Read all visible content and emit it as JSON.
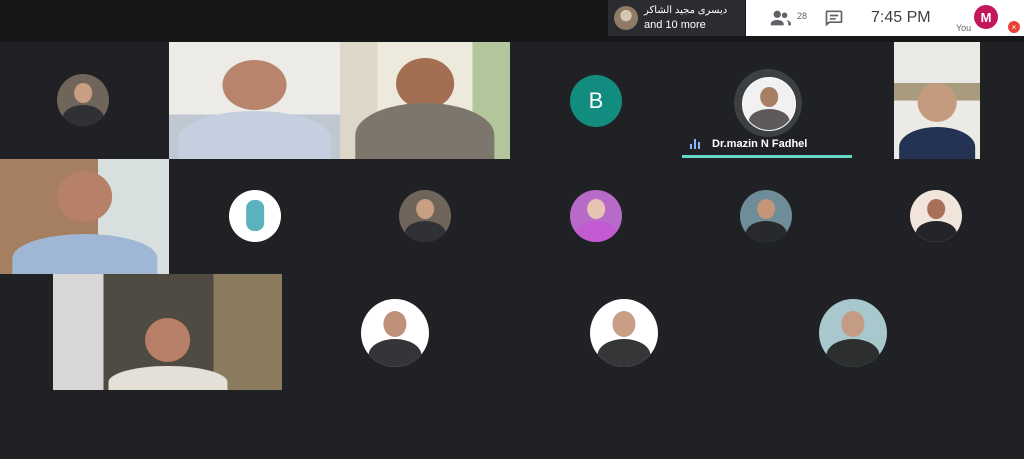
{
  "presenter": {
    "name": "دیسری مجید الشاکر",
    "more": "and 10 more"
  },
  "controls": {
    "people_count": "28",
    "time": "7:45 PM",
    "you_initial": "M",
    "you_label": "You"
  },
  "active_speaker": {
    "name": "Dr.mazin N Fadhel"
  },
  "avatar_b": "B",
  "icons": [
    "people-icon",
    "chat-icon",
    "mic-off-icon",
    "audio-level-icon"
  ],
  "colors": {
    "background": "#202124",
    "accent": "#64d9c7",
    "avatar_b": "#128c7e",
    "you": "#c2185b"
  }
}
